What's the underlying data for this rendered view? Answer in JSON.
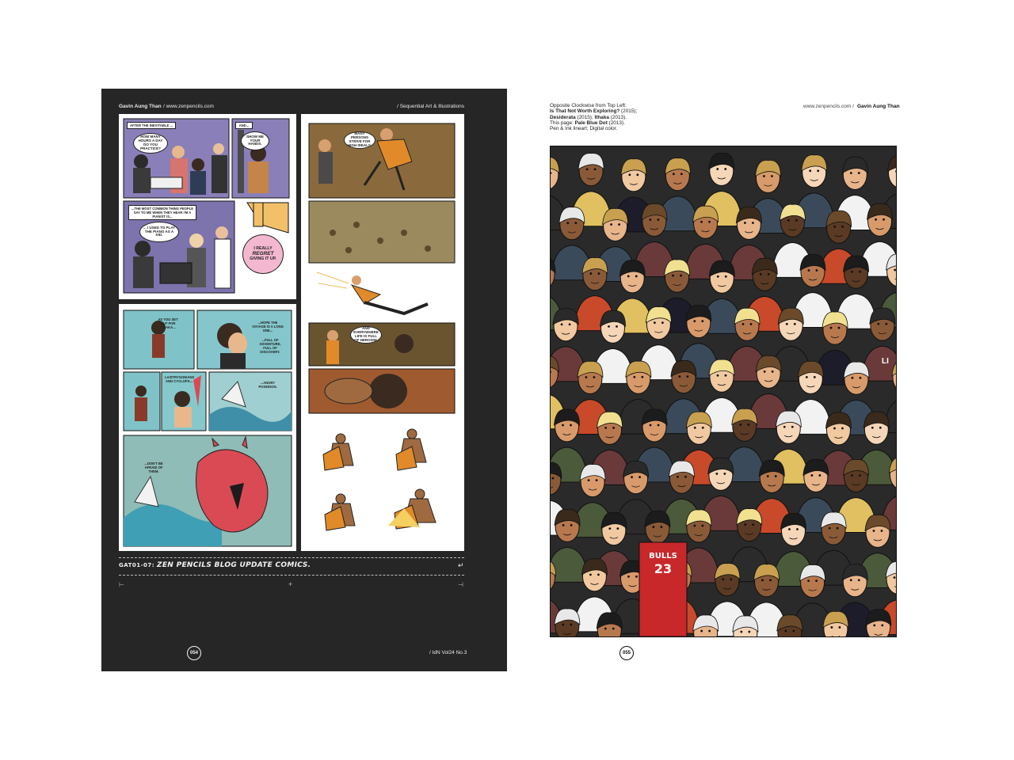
{
  "left_page": {
    "artist": "Gavin Aung Than",
    "url": "/ www.zenpencils.com",
    "section": "/ Sequential Art & Illustrations",
    "caption_code": "GAT01-07: ",
    "caption_title": "ZEN PENCILS BLOG UPDATE COMICS.",
    "page_number": "054",
    "issue": "/ IdN Vol24 No.3",
    "comic_text": {
      "after_inevitable": "AFTER THE INEVITABLE ...",
      "and": "AND...",
      "how_many_hours": "HOW MANY HOURS A DAY DO YOU PRACTICE?",
      "show_me_hands": "SHOW ME YOUR HANDS.",
      "most_common": "...THE MOST COMMON THING PEOPLE SAY TO ME WHEN THEY HEAR I'M A PIANIST IS...",
      "used_to_play": "... I USED TO PLAY THE PIANO AS A KID.",
      "regret_1": "I REALLY",
      "regret_2": "REGRET",
      "regret_3": "GIVING IT UP.",
      "set_out": "AS YOU SET OUT FOR ITHAKA...",
      "hope_voyage": "...HOPE THE VOYAGE IS A LONG ONE...",
      "adventure": "...FULL OF ADVENTURE, FULL OF DISCOVERY.",
      "laistrygonians": "LAISTRYGONIANS AND CYCLOPS...",
      "angry_poseidon": "...ANGRY POSEIDON.",
      "dont_be_afraid": "...DON'T BE AFRAID OF THEM.",
      "many_persons": "MANY PERSONS STRIVE FOR HIGH IDEALS.",
      "everywhere": "AND EVERYWHERE LIFE IS FULL OF HEROISM."
    }
  },
  "right_page": {
    "credits_line1": "Opposite Clockwise from Top Left:",
    "credits_line2_title": "Is That Not Worth Exploring?",
    "credits_line2_year": " (2015);",
    "credits_line3_title": "Desiderata",
    "credits_line3_mid": " (2015); ",
    "credits_line3_title2": "Ithaka",
    "credits_line3_year": " (2013).",
    "credits_line4_pre": "This page: ",
    "credits_line4_title": "Pale Blue Dot",
    "credits_line4_year": " (2013).",
    "credits_line5": "Pen & Ink lineart; Digital color.",
    "url": "www.zenpencils.com /",
    "artist": "Gavin Aung Than",
    "page_number": "055",
    "jersey_text": "BULLS",
    "jersey_number": "23",
    "sign_text": "LI"
  },
  "colors": {
    "left_bg": "#262626",
    "comic_purple": "#8a7fb8",
    "comic_teal": "#7fc3c8",
    "comic_brown": "#8a6a3c",
    "bubble_pink": "#f3b8cf",
    "monster_red": "#d94a55"
  }
}
